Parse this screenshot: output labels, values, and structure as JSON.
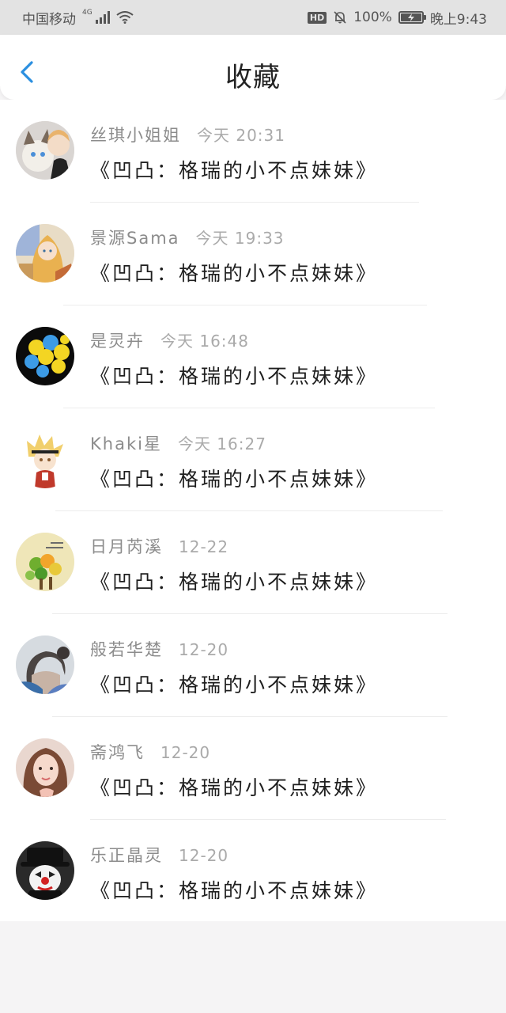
{
  "status_bar": {
    "carrier": "中国移动",
    "network": "4G",
    "hd": "HD",
    "battery": "100%",
    "time": "晚上9:43"
  },
  "header": {
    "title": "收藏",
    "back_icon": "chevron-left-icon"
  },
  "colors": {
    "accent": "#2b8fe0",
    "title": "#222222",
    "meta": "#8c8c8c",
    "time": "#aaaaaa"
  },
  "favorites": [
    {
      "user": "丝琪小姐姐",
      "time": "今天 20:31",
      "title": "《凹凸：格瑞的小不点妹妹》"
    },
    {
      "user": "景源Sama",
      "time": "今天 19:33",
      "title": "《凹凸：格瑞的小不点妹妹》"
    },
    {
      "user": "是灵卉",
      "time": "今天 16:48",
      "title": "《凹凸：格瑞的小不点妹妹》"
    },
    {
      "user": "Khaki星",
      "time": "今天 16:27",
      "title": "《凹凸：格瑞的小不点妹妹》"
    },
    {
      "user": "日月芮溪",
      "time": "12-22",
      "title": "《凹凸：格瑞的小不点妹妹》"
    },
    {
      "user": "般若华楚",
      "time": "12-20",
      "title": "《凹凸：格瑞的小不点妹妹》"
    },
    {
      "user": "斋鸿飞",
      "time": "12-20",
      "title": "《凹凸：格瑞的小不点妹妹》"
    },
    {
      "user": "乐正晶灵",
      "time": "12-20",
      "title": "《凹凸：格瑞的小不点妹妹》"
    }
  ]
}
